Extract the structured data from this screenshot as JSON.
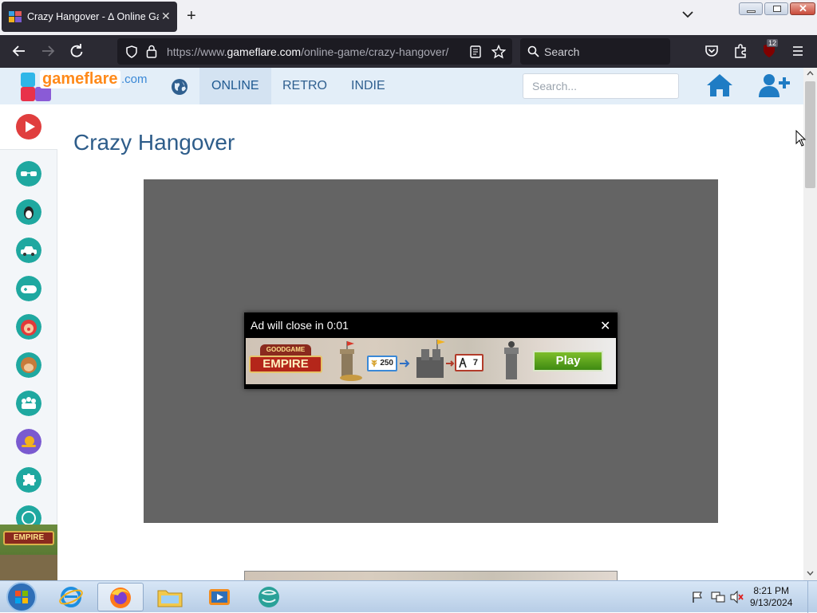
{
  "browser": {
    "tab_title": "Crazy Hangover - ∆ Online Ga",
    "url_prefix": "https://www.",
    "url_host": "gameflare.com",
    "url_path": "/online-game/crazy-hangover/",
    "search_placeholder": "Search",
    "badge_count": "12"
  },
  "site": {
    "logo_text": "gameflare",
    "logo_suffix": ".com",
    "nav": [
      {
        "label": "ONLINE",
        "active": true
      },
      {
        "label": "RETRO",
        "active": false
      },
      {
        "label": "INDIE",
        "active": false
      }
    ],
    "search_placeholder": "Search..."
  },
  "page": {
    "title": "Crazy Hangover"
  },
  "ad": {
    "countdown_text": "Ad will close in 0:01",
    "play_label": "Play",
    "brand_top": "GOODGAME",
    "brand_main": "EMPIRE",
    "resource_value": "250",
    "army_value": "7"
  },
  "taskbar": {
    "time": "8:21 PM",
    "date": "9/13/2024"
  },
  "colors": {
    "accent": "#2e5d8a",
    "brand_orange": "#ff8a1a",
    "sidebar_teal": "#1fa8a0"
  }
}
